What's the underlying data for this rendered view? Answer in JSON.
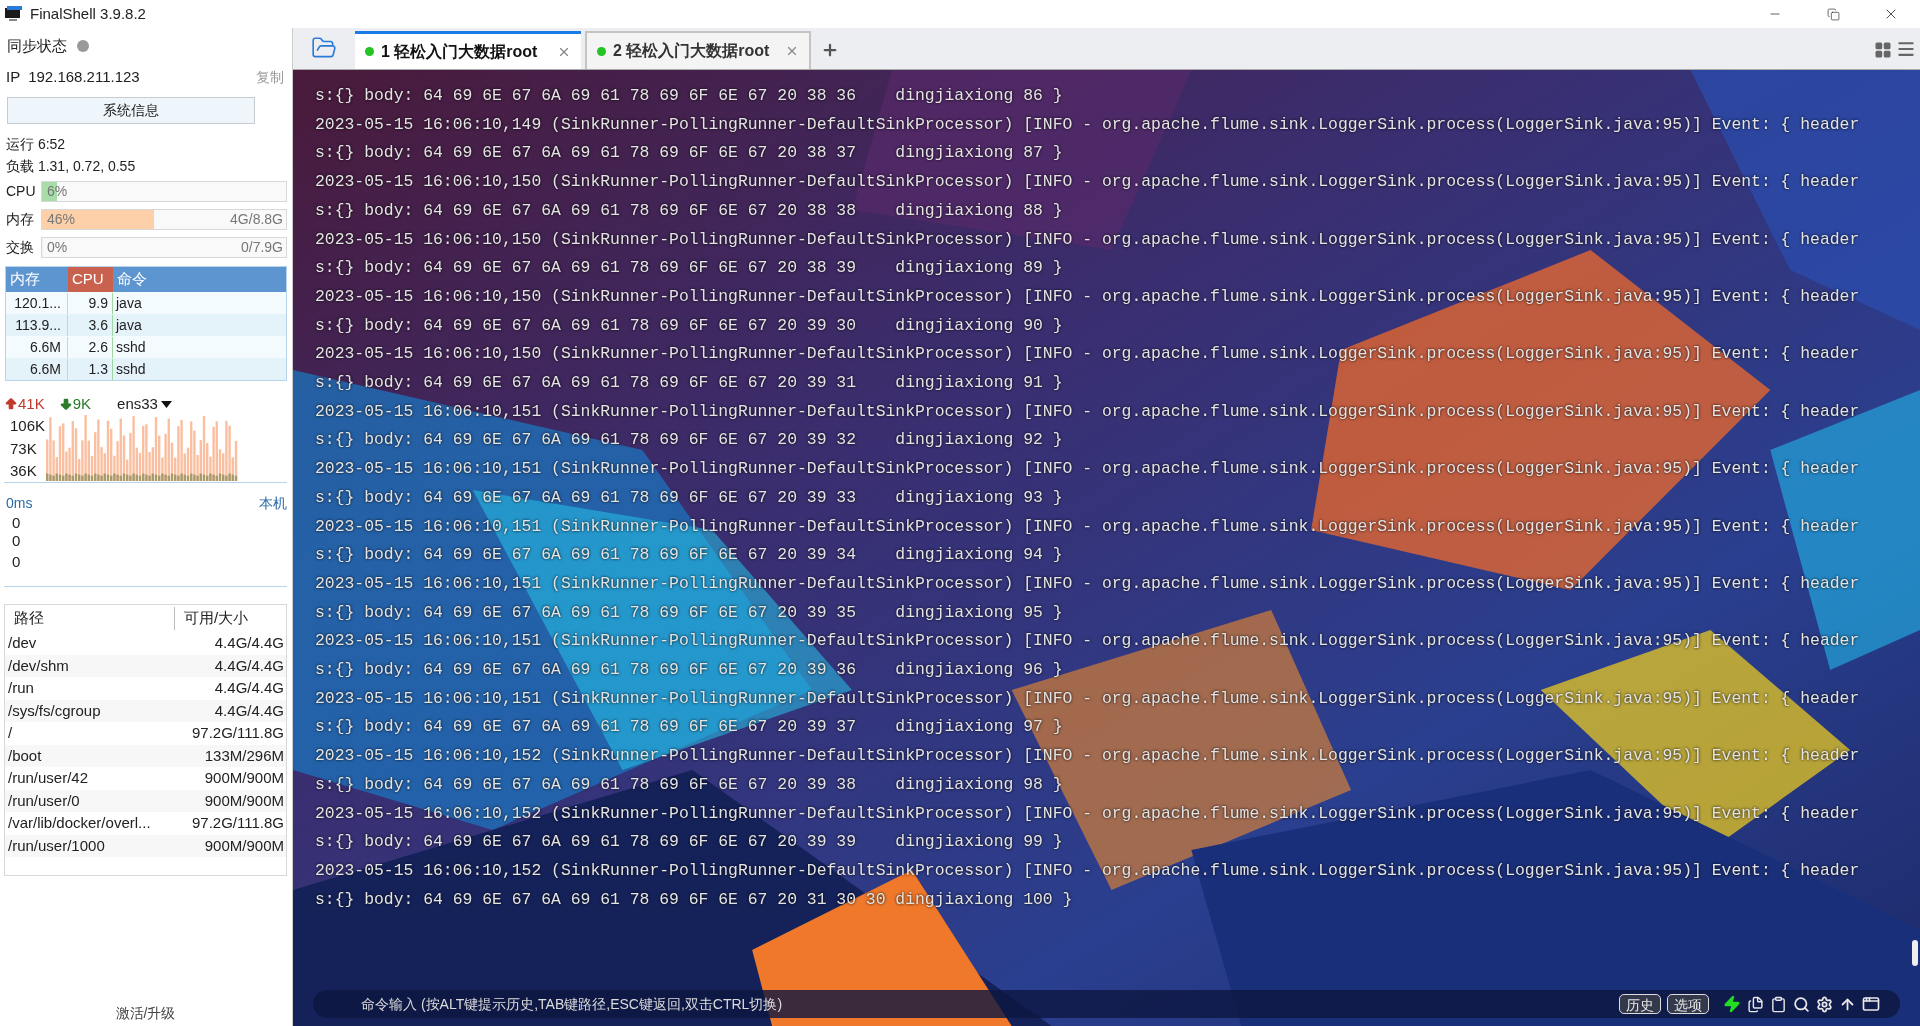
{
  "window": {
    "title": "FinalShell 3.9.8.2"
  },
  "sidebar": {
    "sync_label": "同步状态",
    "sync_online": false,
    "ip_label": "IP",
    "ip": "192.168.211.123",
    "copy": "复制",
    "sysinfo_button": "系统信息",
    "uptime": "运行 6:52",
    "load": "负载 1.31, 0.72, 0.55",
    "meters": [
      {
        "label": "CPU",
        "percent": "6%",
        "level": 0.06,
        "color": "#a8dca8"
      },
      {
        "label": "内存",
        "percent": "46%",
        "amount": "4G/8.8G",
        "level": 0.46,
        "color": "#fdd0a9"
      },
      {
        "label": "交换",
        "percent": "0%",
        "amount": "0/7.9G",
        "level": 0
      }
    ],
    "processes": {
      "columns": [
        {
          "label": "内存",
          "selected": false
        },
        {
          "label": "CPU",
          "selected": true
        },
        {
          "label": "命令",
          "selected": false
        }
      ],
      "rows": [
        {
          "memory": "120.1...",
          "cpu": "9.9",
          "command": "java"
        },
        {
          "memory": "113.9...",
          "cpu": "3.6",
          "command": "java"
        },
        {
          "memory": "6.6M",
          "cpu": "2.6",
          "command": "sshd"
        },
        {
          "memory": "6.6M",
          "cpu": "1.3",
          "command": "sshd"
        }
      ]
    },
    "network": {
      "upload": "41K",
      "download": "9K",
      "interface": "ens33",
      "yticks": [
        "106K",
        "73K",
        "36K"
      ]
    },
    "ping": {
      "latency": "0ms",
      "host": "本机",
      "values": [
        "0",
        "0",
        "0"
      ]
    },
    "disks": {
      "columns": [
        "路径",
        "可用/大小"
      ],
      "rows": [
        {
          "path": "/dev",
          "usage": "4.4G/4.4G"
        },
        {
          "path": "/dev/shm",
          "usage": "4.4G/4.4G"
        },
        {
          "path": "/run",
          "usage": "4.4G/4.4G"
        },
        {
          "path": "/sys/fs/cgroup",
          "usage": "4.4G/4.4G"
        },
        {
          "path": "/",
          "usage": "97.2G/111.8G"
        },
        {
          "path": "/boot",
          "usage": "133M/296M"
        },
        {
          "path": "/run/user/42",
          "usage": "900M/900M"
        },
        {
          "path": "/run/user/0",
          "usage": "900M/900M"
        },
        {
          "path": "/var/lib/docker/overl...",
          "usage": "97.2G/111.8G"
        },
        {
          "path": "/run/user/1000",
          "usage": "900M/900M"
        }
      ]
    },
    "activate": "激活/升级"
  },
  "tabs": [
    {
      "label": "1 轻松入门大数据root",
      "selected": true,
      "connected": true
    },
    {
      "label": "2 轻松入门大数据root",
      "selected": false,
      "connected": true
    }
  ],
  "terminal": {
    "lines": [
      "s:{} body: 64 69 6E 67 6A 69 61 78 69 6F 6E 67 20 38 36    dingjiaxiong 86 }",
      "2023-05-15 16:06:10,149 (SinkRunner-PollingRunner-DefaultSinkProcessor) [INFO - org.apache.flume.sink.LoggerSink.process(LoggerSink.java:95)] Event: { header",
      "s:{} body: 64 69 6E 67 6A 69 61 78 69 6F 6E 67 20 38 37    dingjiaxiong 87 }",
      "2023-05-15 16:06:10,150 (SinkRunner-PollingRunner-DefaultSinkProcessor) [INFO - org.apache.flume.sink.LoggerSink.process(LoggerSink.java:95)] Event: { header",
      "s:{} body: 64 69 6E 67 6A 69 61 78 69 6F 6E 67 20 38 38    dingjiaxiong 88 }",
      "2023-05-15 16:06:10,150 (SinkRunner-PollingRunner-DefaultSinkProcessor) [INFO - org.apache.flume.sink.LoggerSink.process(LoggerSink.java:95)] Event: { header",
      "s:{} body: 64 69 6E 67 6A 69 61 78 69 6F 6E 67 20 38 39    dingjiaxiong 89 }",
      "2023-05-15 16:06:10,150 (SinkRunner-PollingRunner-DefaultSinkProcessor) [INFO - org.apache.flume.sink.LoggerSink.process(LoggerSink.java:95)] Event: { header",
      "s:{} body: 64 69 6E 67 6A 69 61 78 69 6F 6E 67 20 39 30    dingjiaxiong 90 }",
      "2023-05-15 16:06:10,150 (SinkRunner-PollingRunner-DefaultSinkProcessor) [INFO - org.apache.flume.sink.LoggerSink.process(LoggerSink.java:95)] Event: { header",
      "s:{} body: 64 69 6E 67 6A 69 61 78 69 6F 6E 67 20 39 31    dingjiaxiong 91 }",
      "2023-05-15 16:06:10,151 (SinkRunner-PollingRunner-DefaultSinkProcessor) [INFO - org.apache.flume.sink.LoggerSink.process(LoggerSink.java:95)] Event: { header",
      "s:{} body: 64 69 6E 67 6A 69 61 78 69 6F 6E 67 20 39 32    dingjiaxiong 92 }",
      "2023-05-15 16:06:10,151 (SinkRunner-PollingRunner-DefaultSinkProcessor) [INFO - org.apache.flume.sink.LoggerSink.process(LoggerSink.java:95)] Event: { header",
      "s:{} body: 64 69 6E 67 6A 69 61 78 69 6F 6E 67 20 39 33    dingjiaxiong 93 }",
      "2023-05-15 16:06:10,151 (SinkRunner-PollingRunner-DefaultSinkProcessor) [INFO - org.apache.flume.sink.LoggerSink.process(LoggerSink.java:95)] Event: { header",
      "s:{} body: 64 69 6E 67 6A 69 61 78 69 6F 6E 67 20 39 34    dingjiaxiong 94 }",
      "2023-05-15 16:06:10,151 (SinkRunner-PollingRunner-DefaultSinkProcessor) [INFO - org.apache.flume.sink.LoggerSink.process(LoggerSink.java:95)] Event: { header",
      "s:{} body: 64 69 6E 67 6A 69 61 78 69 6F 6E 67 20 39 35    dingjiaxiong 95 }",
      "2023-05-15 16:06:10,151 (SinkRunner-PollingRunner-DefaultSinkProcessor) [INFO - org.apache.flume.sink.LoggerSink.process(LoggerSink.java:95)] Event: { header",
      "s:{} body: 64 69 6E 67 6A 69 61 78 69 6F 6E 67 20 39 36    dingjiaxiong 96 }",
      "2023-05-15 16:06:10,151 (SinkRunner-PollingRunner-DefaultSinkProcessor) [INFO - org.apache.flume.sink.LoggerSink.process(LoggerSink.java:95)] Event: { header",
      "s:{} body: 64 69 6E 67 6A 69 61 78 69 6F 6E 67 20 39 37    dingjiaxiong 97 }",
      "2023-05-15 16:06:10,152 (SinkRunner-PollingRunner-DefaultSinkProcessor) [INFO - org.apache.flume.sink.LoggerSink.process(LoggerSink.java:95)] Event: { header",
      "s:{} body: 64 69 6E 67 6A 69 61 78 69 6F 6E 67 20 39 38    dingjiaxiong 98 }",
      "2023-05-15 16:06:10,152 (SinkRunner-PollingRunner-DefaultSinkProcessor) [INFO - org.apache.flume.sink.LoggerSink.process(LoggerSink.java:95)] Event: { header",
      "s:{} body: 64 69 6E 67 6A 69 61 78 69 6F 6E 67 20 39 39    dingjiaxiong 99 }",
      "2023-05-15 16:06:10,152 (SinkRunner-PollingRunner-DefaultSinkProcessor) [INFO - org.apache.flume.sink.LoggerSink.process(LoggerSink.java:95)] Event: { header",
      "s:{} body: 64 69 6E 67 6A 69 61 78 69 6F 6E 67 20 31 30 30 dingjiaxiong 100 }"
    ]
  },
  "command_bar": {
    "placeholder": "命令输入 (按ALT键提示历史,TAB键路径,ESC键返回,双击CTRL切换)",
    "buttons": [
      "历史",
      "选项"
    ]
  }
}
